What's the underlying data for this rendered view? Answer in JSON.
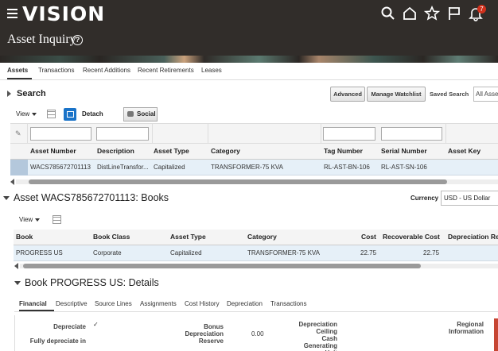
{
  "brand": {
    "logo": "VISION",
    "notification_count": "7"
  },
  "header": {
    "title": "Asset Inquiry"
  },
  "tabs": [
    {
      "label": "Assets",
      "active": true
    },
    {
      "label": "Transactions"
    },
    {
      "label": "Recent Additions"
    },
    {
      "label": "Recent Retirements"
    },
    {
      "label": "Leases"
    }
  ],
  "search": {
    "label": "Search",
    "advanced_label": "Advanced",
    "manage_watchlist_label": "Manage Watchlist",
    "saved_search_label": "Saved Search",
    "saved_search_value": "All Assets"
  },
  "assets_toolbar": {
    "view_label": "View",
    "detach_label": "Detach",
    "social_label": "Social"
  },
  "assets_table": {
    "columns": [
      "Asset Number",
      "Description",
      "Asset Type",
      "Category",
      "Tag Number",
      "Serial Number",
      "Asset Key"
    ],
    "rows": [
      [
        "WACS785672701113",
        "DistLineTransfor...",
        "Capitalized",
        "TRANSFORMER-75 KVA",
        "RL-AST-BN-106",
        "RL-AST-SN-106",
        ""
      ]
    ]
  },
  "books_section": {
    "title": "Asset WACS785672701113: Books",
    "currency_label": "Currency",
    "currency_value": "USD - US Dollar",
    "view_label": "View",
    "columns": [
      "Book",
      "Book Class",
      "Asset Type",
      "Category",
      "Cost",
      "Recoverable Cost",
      "Depreciation Reserve"
    ],
    "rows": [
      [
        "PROGRESS US",
        "Corporate",
        "Capitalized",
        "TRANSFORMER-75 KVA",
        "22.75",
        "22.75",
        ""
      ]
    ]
  },
  "details_section": {
    "title": "Book PROGRESS US: Details",
    "tabs": [
      {
        "label": "Financial",
        "active": true
      },
      {
        "label": "Descriptive"
      },
      {
        "label": "Source Lines"
      },
      {
        "label": "Assignments"
      },
      {
        "label": "Cost History"
      },
      {
        "label": "Depreciation"
      },
      {
        "label": "Transactions"
      }
    ],
    "fields": {
      "depreciate_label": "Depreciate",
      "depreciate_value": "✓",
      "fully_depreciate_label": "Fully depreciate in",
      "bonus_label": "Bonus Depreciation Reserve",
      "bonus_value": "0.00",
      "ceiling_label": "Depreciation Ceiling",
      "cash_label": "Cash Generating Unit",
      "regional_label": "Regional Information"
    }
  },
  "colors": {
    "header_bg": "#312d2a",
    "accent_blue": "#1a73c8",
    "selected_row": "#e6f0f8",
    "accent_red": "#c74634"
  }
}
